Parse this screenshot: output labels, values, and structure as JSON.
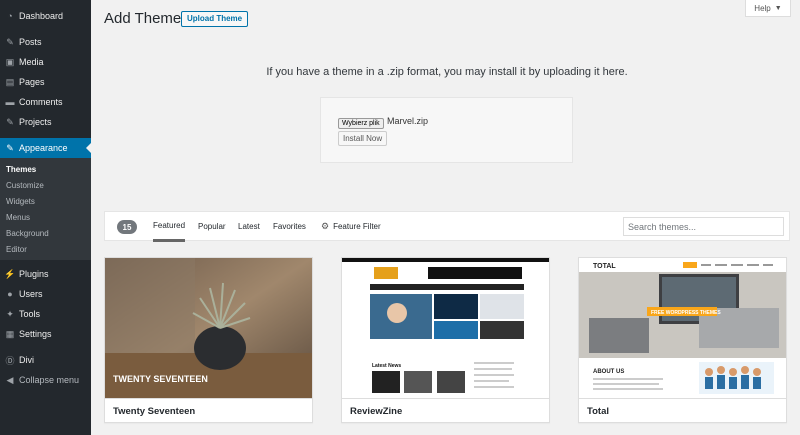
{
  "sidebar": {
    "items": [
      {
        "label": "Dashboard",
        "icon": "dashboard-icon"
      },
      {
        "label": "Posts",
        "icon": "pin-icon"
      },
      {
        "label": "Media",
        "icon": "media-icon"
      },
      {
        "label": "Pages",
        "icon": "pages-icon"
      },
      {
        "label": "Comments",
        "icon": "comments-icon"
      },
      {
        "label": "Projects",
        "icon": "pin-icon"
      },
      {
        "label": "Appearance",
        "icon": "brush-icon"
      },
      {
        "label": "Plugins",
        "icon": "plugin-icon"
      },
      {
        "label": "Users",
        "icon": "users-icon"
      },
      {
        "label": "Tools",
        "icon": "wrench-icon"
      },
      {
        "label": "Settings",
        "icon": "settings-icon"
      },
      {
        "label": "Divi",
        "icon": "divi-icon"
      },
      {
        "label": "Collapse menu",
        "icon": "collapse-icon"
      }
    ],
    "submenu": [
      "Themes",
      "Customize",
      "Widgets",
      "Menus",
      "Background",
      "Editor"
    ]
  },
  "header": {
    "title": "Add Themes",
    "upload_label": "Upload Theme",
    "help_label": "Help"
  },
  "upload": {
    "description": "If you have a theme in a .zip format, you may install it by uploading it here.",
    "file_button": "Wybierz plik",
    "file_name": "Marvel.zip",
    "install_label": "Install Now"
  },
  "filter": {
    "count": "15",
    "tabs": [
      "Featured",
      "Popular",
      "Latest",
      "Favorites"
    ],
    "feature_filter": "Feature Filter",
    "search_placeholder": "Search themes..."
  },
  "themes": [
    {
      "name": "Twenty Seventeen",
      "shot_caption": "TWENTY SEVENTEEN"
    },
    {
      "name": "ReviewZine",
      "shot_caption": "Latest News"
    },
    {
      "name": "Total",
      "shot_caption": "FREE WORDPRESS THEMES"
    }
  ],
  "colors": {
    "sidebar_bg": "#23282d",
    "active_bg": "#0073aa",
    "page_bg": "#f1f1f1"
  }
}
